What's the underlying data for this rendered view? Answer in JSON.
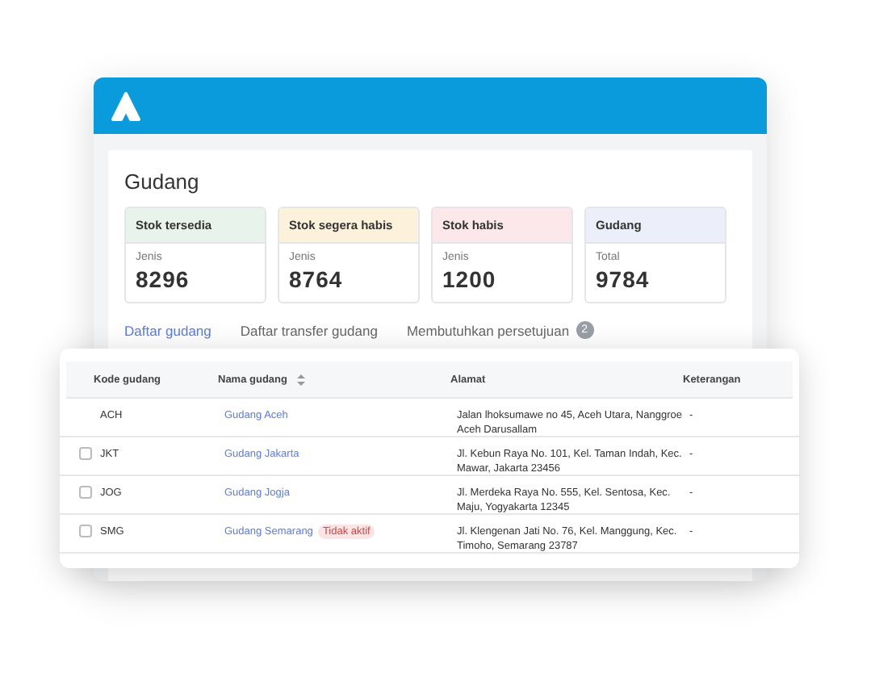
{
  "page": {
    "title": "Gudang"
  },
  "stats": [
    {
      "label": "Stok tersedia",
      "sublabel": "Jenis",
      "value": "8296",
      "color": "#e8f3eb"
    },
    {
      "label": "Stok segera habis",
      "sublabel": "Jenis",
      "value": "8764",
      "color": "#fcf2db"
    },
    {
      "label": "Stok habis",
      "sublabel": "Jenis",
      "value": "1200",
      "color": "#fce8ea"
    },
    {
      "label": "Gudang",
      "sublabel": "Total",
      "value": "9784",
      "color": "#eceefa"
    }
  ],
  "tabs": [
    {
      "label": "Daftar gudang",
      "selected": true
    },
    {
      "label": "Daftar transfer gudang",
      "selected": false
    },
    {
      "label": "Membutuhkan persetujuan",
      "selected": false,
      "count": "2"
    }
  ],
  "table": {
    "columns": [
      "Kode gudang",
      "Nama gudang",
      "Alamat",
      "Keterangan"
    ],
    "rows": [
      {
        "code": "ACH",
        "name": "Gudang Aceh",
        "address": "Jalan lhoksumawe no 45, Aceh Utara, Nanggroe Aceh Darusallam",
        "note": "-"
      },
      {
        "checked": false,
        "code": "JKT",
        "name": "Gudang Jakarta",
        "address": "Jl. Kebun Raya No. 101, Kel. Taman Indah, Kec. Mawar, Jakarta 23456",
        "note": "-"
      },
      {
        "checked": false,
        "code": "JOG",
        "name": "Gudang Jogja",
        "address": "Jl. Merdeka Raya No. 555, Kel. Sentosa, Kec. Maju, Yogyakarta 12345",
        "note": "-"
      },
      {
        "checked": false,
        "code": "SMG",
        "name": "Gudang Semarang",
        "status": "Tidak aktif",
        "address": "Jl. Klengenan Jati No. 76, Kel. Manggung, Kec. Timoho, Semarang 23787",
        "note": "-"
      }
    ]
  }
}
